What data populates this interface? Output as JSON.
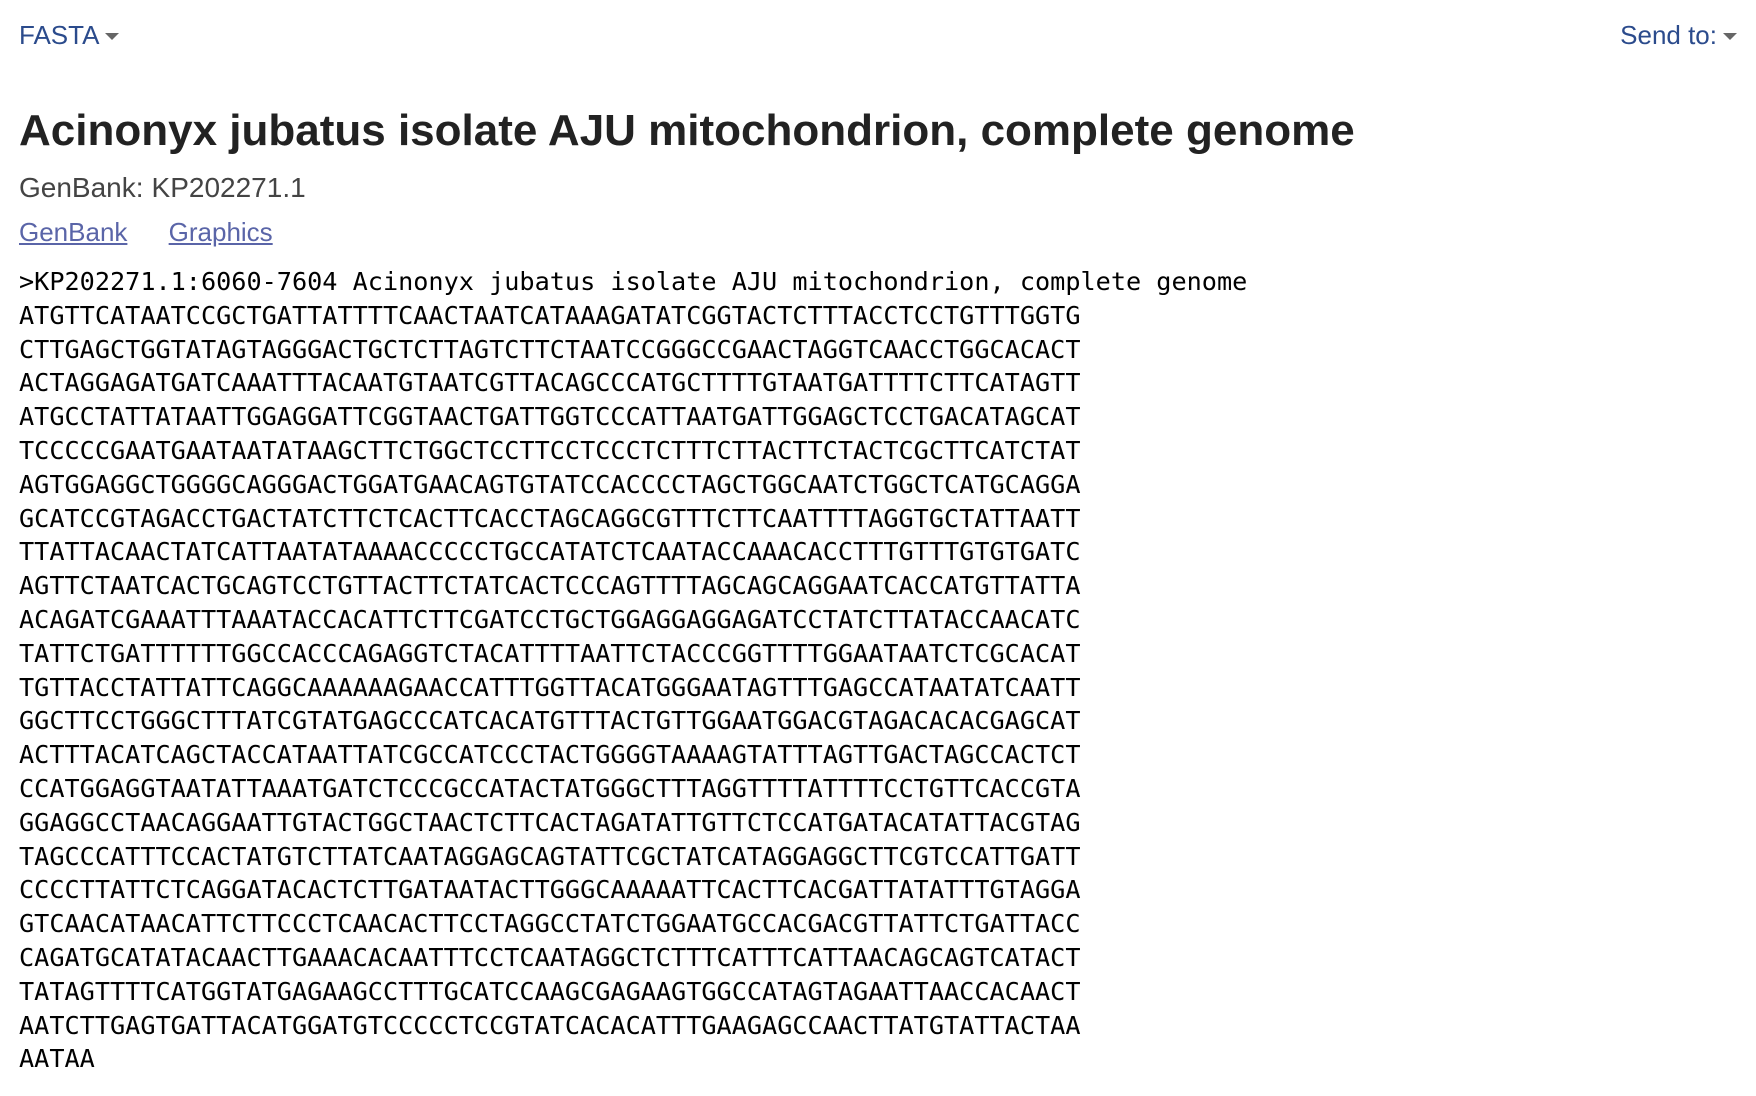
{
  "header": {
    "format_label": "FASTA",
    "send_to_label": "Send to:",
    "icons": {
      "format_dropdown": "chevron-down-icon",
      "send_to_dropdown": "chevron-down-icon"
    }
  },
  "record": {
    "title": "Acinonyx jubatus isolate AJU mitochondrion, complete genome",
    "accession_label": "GenBank:",
    "accession": "KP202271.1"
  },
  "links": {
    "genbank": "GenBank",
    "graphics": "Graphics"
  },
  "sequence": {
    "defline": ">KP202271.1:6060-7604 Acinonyx jubatus isolate AJU mitochondrion, complete genome",
    "lines": [
      "ATGTTCATAATCCGCTGATTATTTTCAACTAATCATAAAGATATCGGTACTCTTTACCTCCTGTTTGGTG",
      "CTTGAGCTGGTATAGTAGGGACTGCTCTTAGTCTTCTAATCCGGGCCGAACTAGGTCAACCTGGCACACT",
      "ACTAGGAGATGATCAAATTTACAATGTAATCGTTACAGCCCATGCTTTTGTAATGATTTTCTTCATAGTT",
      "ATGCCTATTATAATTGGAGGATTCGGTAACTGATTGGTCCCATTAATGATTGGAGCTCCTGACATAGCAT",
      "TCCCCCGAATGAATAATATAAGCTTCTGGCTCCTTCCTCCCTCTTTCTTACTTCTACTCGCTTCATCTAT",
      "AGTGGAGGCTGGGGCAGGGACTGGATGAACAGTGTATCCACCCCTAGCTGGCAATCTGGCTCATGCAGGA",
      "GCATCCGTAGACCTGACTATCTTCTCACTTCACCTAGCAGGCGTTTCTTCAATTTTAGGTGCTATTAATT",
      "TTATTACAACTATCATTAATATAAAACCCCCTGCCATATCTCAATACCAAACACCTTTGTTTGTGTGATC",
      "AGTTCTAATCACTGCAGTCCTGTTACTTCTATCACTCCCAGTTTTAGCAGCAGGAATCACCATGTTATTA",
      "ACAGATCGAAATTTAAATACCACATTCTTCGATCCTGCTGGAGGAGGAGATCCTATCTTATACCAACATC",
      "TATTCTGATTTTTTGGCCACCCAGAGGTCTACATTTTAATTCTACCCGGTTTTGGAATAATCTCGCACAT",
      "TGTTACCTATTATTCAGGCAAAAAAGAACCATTTGGTTACATGGGAATAGTTTGAGCCATAATATCAATT",
      "GGCTTCCTGGGCTTTATCGTATGAGCCCATCACATGTTTACTGTTGGAATGGACGTAGACACACGAGCAT",
      "ACTTTACATCAGCTACCATAATTATCGCCATCCCTACTGGGGTAAAAGTATTTAGTTGACTAGCCACTCT",
      "CCATGGAGGTAATATTAAATGATCTCCCGCCATACTATGGGCTTTAGGTTTTATTTTCCTGTTCACCGTA",
      "GGAGGCCTAACAGGAATTGTACTGGCTAACTCTTCACTAGATATTGTTCTCCATGATACATATTACGTAG",
      "TAGCCCATTTCCACTATGTCTTATCAATAGGAGCAGTATTCGCTATCATAGGAGGCTTCGTCCATTGATT",
      "CCCCTTATTCTCAGGATACACTCTTGATAATACTTGGGCAAAAATTCACTTCACGATTATATTTGTAGGA",
      "GTCAACATAACATTCTTCCCTCAACACTTCCTAGGCCTATCTGGAATGCCACGACGTTATTCTGATTACC",
      "CAGATGCATATACAACTTGAAACACAATTTCCTCAATAGGCTCTTTCATTTCATTAACAGCAGTCATACT",
      "TATAGTTTTCATGGTATGAGAAGCCTTTGCATCCAAGCGAGAAGTGGCCATAGTAGAATTAACCACAACT",
      "AATCTTGAGTGATTACATGGATGTCCCCCTCCGTATCACACATTTGAAGAGCCAACTTATGTATTACTAA",
      "AATAA"
    ]
  }
}
